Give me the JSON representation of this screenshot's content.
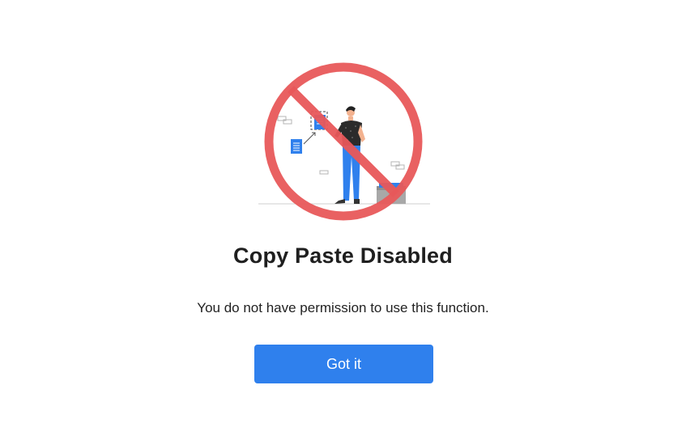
{
  "dialog": {
    "title": "Copy Paste Disabled",
    "message": "You do not have permission to use this function.",
    "confirm_label": "Got it"
  },
  "illustration": {
    "icon": "no-copy-paste-prohibited-icon",
    "prohibition_color": "#e8585a",
    "accent_color": "#2f80ed"
  },
  "colors": {
    "button_background": "#2f80ed",
    "button_text": "#ffffff",
    "title_text": "#1f1f1f",
    "background": "#ffffff"
  }
}
